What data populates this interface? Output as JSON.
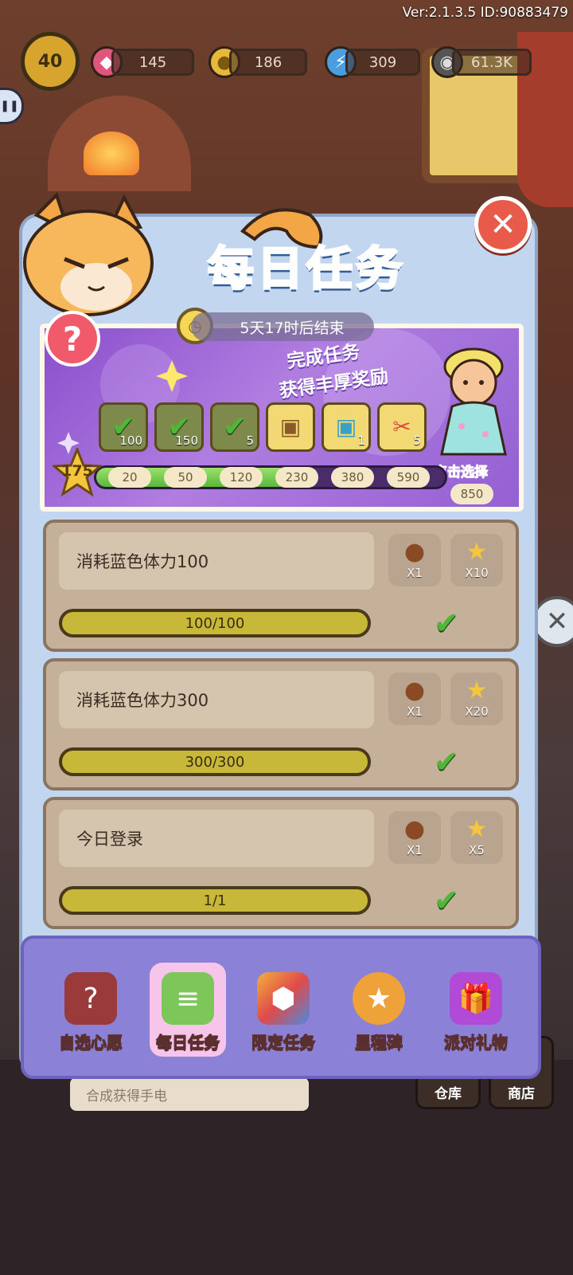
{
  "hud": {
    "version": "Ver:2.1.3.5 ID:90883479",
    "level": "40",
    "gems": "145",
    "coins": "186",
    "energy": "309",
    "seeds": "61.3K"
  },
  "panel": {
    "title": "每日任务",
    "timer": "5天17时后结束",
    "promo_line1": "完成任务",
    "promo_line2": "获得丰厚奖励",
    "pick_label": "点击选择",
    "current_score": "175",
    "progress_fraction": 0.55,
    "rewards": [
      {
        "state": "claimed",
        "count": "100",
        "icon": "gem-icon"
      },
      {
        "state": "claimed",
        "count": "150",
        "icon": "gem-icon"
      },
      {
        "state": "claimed",
        "count": "5",
        "icon": "acorn-icon"
      },
      {
        "state": "locked",
        "count": "",
        "icon": "wooden-chest-icon"
      },
      {
        "state": "locked",
        "count": "1",
        "icon": "blue-chest-icon"
      },
      {
        "state": "locked",
        "count": "5",
        "icon": "scissors-icon"
      }
    ],
    "milestones": [
      "20",
      "50",
      "120",
      "230",
      "380",
      "590",
      "850"
    ]
  },
  "tasks": [
    {
      "name": "消耗蓝色体力100",
      "progress": "100/100",
      "reward1": "X1",
      "reward2": "X10"
    },
    {
      "name": "消耗蓝色体力300",
      "progress": "300/300",
      "reward1": "X1",
      "reward2": "X20"
    },
    {
      "name": "今日登录",
      "progress": "1/1",
      "reward1": "X1",
      "reward2": "X5"
    }
  ],
  "tabs": [
    {
      "label": "自选心愿",
      "icon": "wish-icon"
    },
    {
      "label": "每日任务",
      "icon": "daily-task-icon"
    },
    {
      "label": "限定任务",
      "icon": "limited-task-icon"
    },
    {
      "label": "里程碑",
      "icon": "milestone-icon"
    },
    {
      "label": "派对礼物",
      "icon": "gift-icon"
    }
  ],
  "background": {
    "hint": "合成获得手电",
    "warehouse": "仓库",
    "shop": "商店"
  },
  "colors": {
    "panel": "#c3d6ef",
    "title": "#4e9ee0",
    "tabbar": "#8b82d7",
    "check": "#4fb63a",
    "progress": "#58b83a"
  }
}
